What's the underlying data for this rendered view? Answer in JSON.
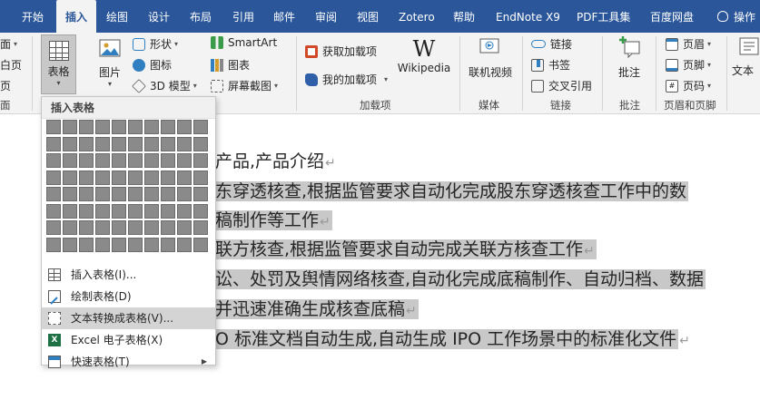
{
  "tabs": {
    "home": "开始",
    "insert": "插入",
    "draw": "绘图",
    "design": "设计",
    "layout": "布局",
    "references": "引用",
    "mailings": "邮件",
    "review": "审阅",
    "view": "视图",
    "zotero": "Zotero",
    "help": "帮助",
    "endnote": "EndNote X9",
    "pdf": "PDF工具集",
    "baidu": "百度网盘",
    "tellme": "操作"
  },
  "ribbon": {
    "partial_top": "面",
    "partial_mid": "白页",
    "partial_low": "页",
    "partial_label": "面",
    "table": "表格",
    "picture": "图片",
    "shapes": "形状",
    "icons": "图标",
    "model3d": "3D 模型",
    "smartart": "SmartArt",
    "chart": "图表",
    "screenshot": "屏幕截图",
    "get_addins": "获取加载项",
    "my_addins": "我的加载项",
    "wikipedia": "Wikipedia",
    "addins_group": "加载项",
    "online_video": "联机视频",
    "media_group": "媒体",
    "link": "链接",
    "bookmark": "书签",
    "crossref": "交叉引用",
    "links_group": "链接",
    "comment": "批注",
    "comments_group": "批注",
    "header": "页眉",
    "footer": "页脚",
    "page_number": "页码",
    "header_footer_group": "页眉和页脚",
    "textbox_partial": "文本"
  },
  "dropdown": {
    "header": "插入表格",
    "items": [
      {
        "label": "插入表格(I)..."
      },
      {
        "label": "绘制表格(D)"
      },
      {
        "label": "文本转换成表格(V)..."
      },
      {
        "label": "Excel 电子表格(X)"
      },
      {
        "label": "快速表格(T)"
      }
    ]
  },
  "document": {
    "lines": [
      "产品,产品介绍",
      "东穿透核查,根据监管要求自动化完成股东穿透核查工作中的数",
      "稿制作等工作",
      "联方核查,根据监管要求自动完成关联方核查工作",
      "讼、处罚及舆情网络核查,自动化完成底稿制作、自动归档、数据",
      "并迅速准确生成核查底稿",
      "O 标准文档自动生成,自动生成 IPO 工作场景中的标准化文件"
    ],
    "para_mark": "↵"
  },
  "colors": {
    "tabbar": "#2b579a",
    "ribbon": "#f3f3f3",
    "selection": "#c8c8c8",
    "grid_cell": "#8a8a8a"
  }
}
